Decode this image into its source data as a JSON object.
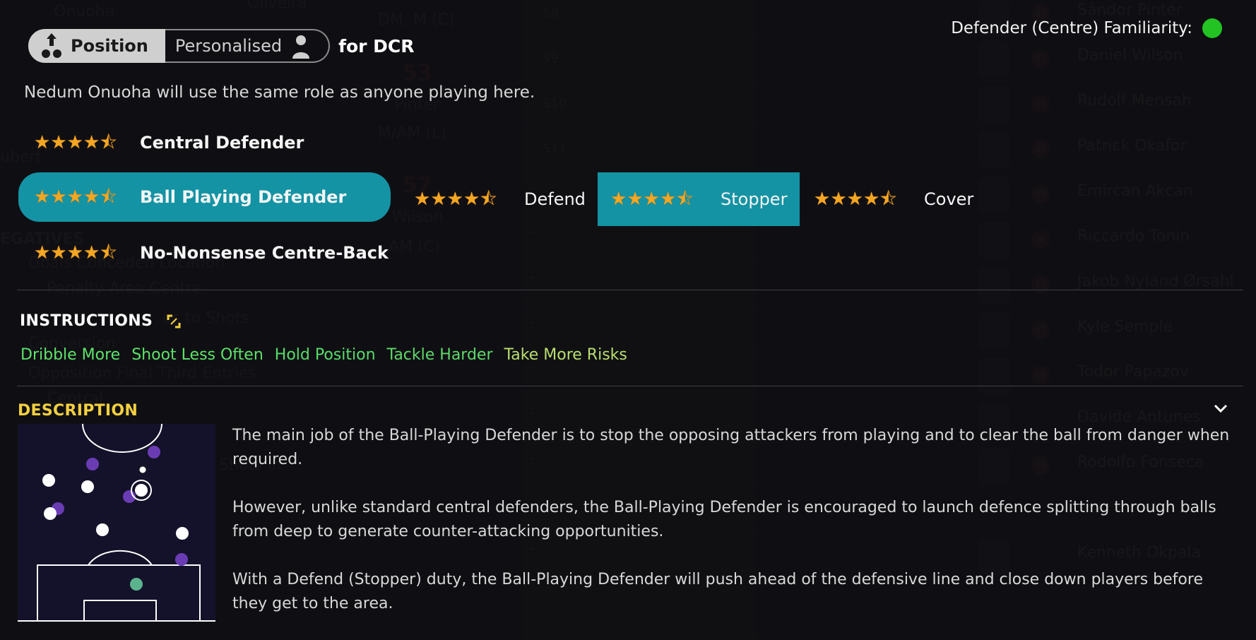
{
  "background": {
    "top_names": [
      "Onuoha",
      "Oliveira"
    ],
    "positions": [
      "DM, M (C)",
      "M/AM (L)",
      "AM (C)"
    ],
    "numbers": [
      "53",
      "57"
    ],
    "slots": [
      "S8",
      "S9",
      "S10",
      "S11"
    ],
    "mid_names": [
      "Pinter",
      "Wilson"
    ],
    "left_partial": "ubert",
    "negatives_heading": "EGATIVES",
    "stats": [
      "Goals Conceded Location",
      "Penalty Area Centre",
      "Conversion",
      "Opposition Final Third Entries",
      "Central",
      "Shots in"
    ],
    "stat_partial": "es to Shots",
    "dashes": [
      "-",
      "-",
      "-",
      "-",
      "-",
      "-",
      "-",
      "-"
    ],
    "players": [
      {
        "num": "63",
        "name": "Sándor Pintér"
      },
      {
        "num": "57",
        "name": "Daniel Wilson"
      },
      {
        "num": "35",
        "name": "Rudolf Mensah"
      },
      {
        "num": "49",
        "name": "Patrick Okafor"
      },
      {
        "num": "55",
        "name": "Emircan Akcan"
      },
      {
        "num": "9",
        "name": "Riccardo Tonin"
      },
      {
        "num": "13",
        "name": "Jakob Nyland Ørsahl"
      },
      {
        "num": "47",
        "name": "Kyle Semple"
      },
      {
        "num": "50",
        "name": "Todor Papazov"
      },
      {
        "num": "",
        "name": "Davide Antunes"
      },
      {
        "num": "10",
        "name": "Rodolfo Fonseca"
      },
      {
        "num": "",
        "name": "Kenneth Okpala"
      }
    ]
  },
  "tabs": {
    "position_label": "Position",
    "personalised_label": "Personalised",
    "for_label": "for DCR"
  },
  "familiarity": {
    "label": "Defender (Centre) Familiarity:",
    "status_color": "#22c322"
  },
  "subtitle": "Nedum Onuoha will use the same role as anyone playing here.",
  "roles": [
    {
      "name": "Central Defender",
      "rating": 4.5,
      "selected": false
    },
    {
      "name": "Ball Playing Defender",
      "rating": 4.5,
      "selected": true
    },
    {
      "name": "No-Nonsense Centre-Back",
      "rating": 4.5,
      "selected": false
    }
  ],
  "duties": [
    {
      "name": "Defend",
      "rating": 4.5,
      "selected": false
    },
    {
      "name": "Stopper",
      "rating": 4.5,
      "selected": true
    },
    {
      "name": "Cover",
      "rating": 4.5,
      "selected": false
    }
  ],
  "instructions": {
    "title": "INSTRUCTIONS",
    "items": [
      "Dribble More",
      "Shoot Less Often",
      "Hold Position",
      "Tackle Harder",
      "Take More Risks"
    ]
  },
  "description": {
    "title": "DESCRIPTION",
    "paragraphs": [
      "The main job of the Ball-Playing Defender is to stop the opposing attackers from playing and to clear the ball from danger when required.",
      "However, unlike standard central defenders, the Ball-Playing Defender is encouraged to launch defence splitting through balls from deep to generate counter-attacking opportunities.",
      "With a Defend (Stopper) duty, the Ball-Playing Defender will push ahead of the defensive line and close down players before they get to the area."
    ]
  },
  "colors": {
    "accent": "#1493a4",
    "section_yellow": "#f4d03f",
    "star": "#f5a623"
  }
}
